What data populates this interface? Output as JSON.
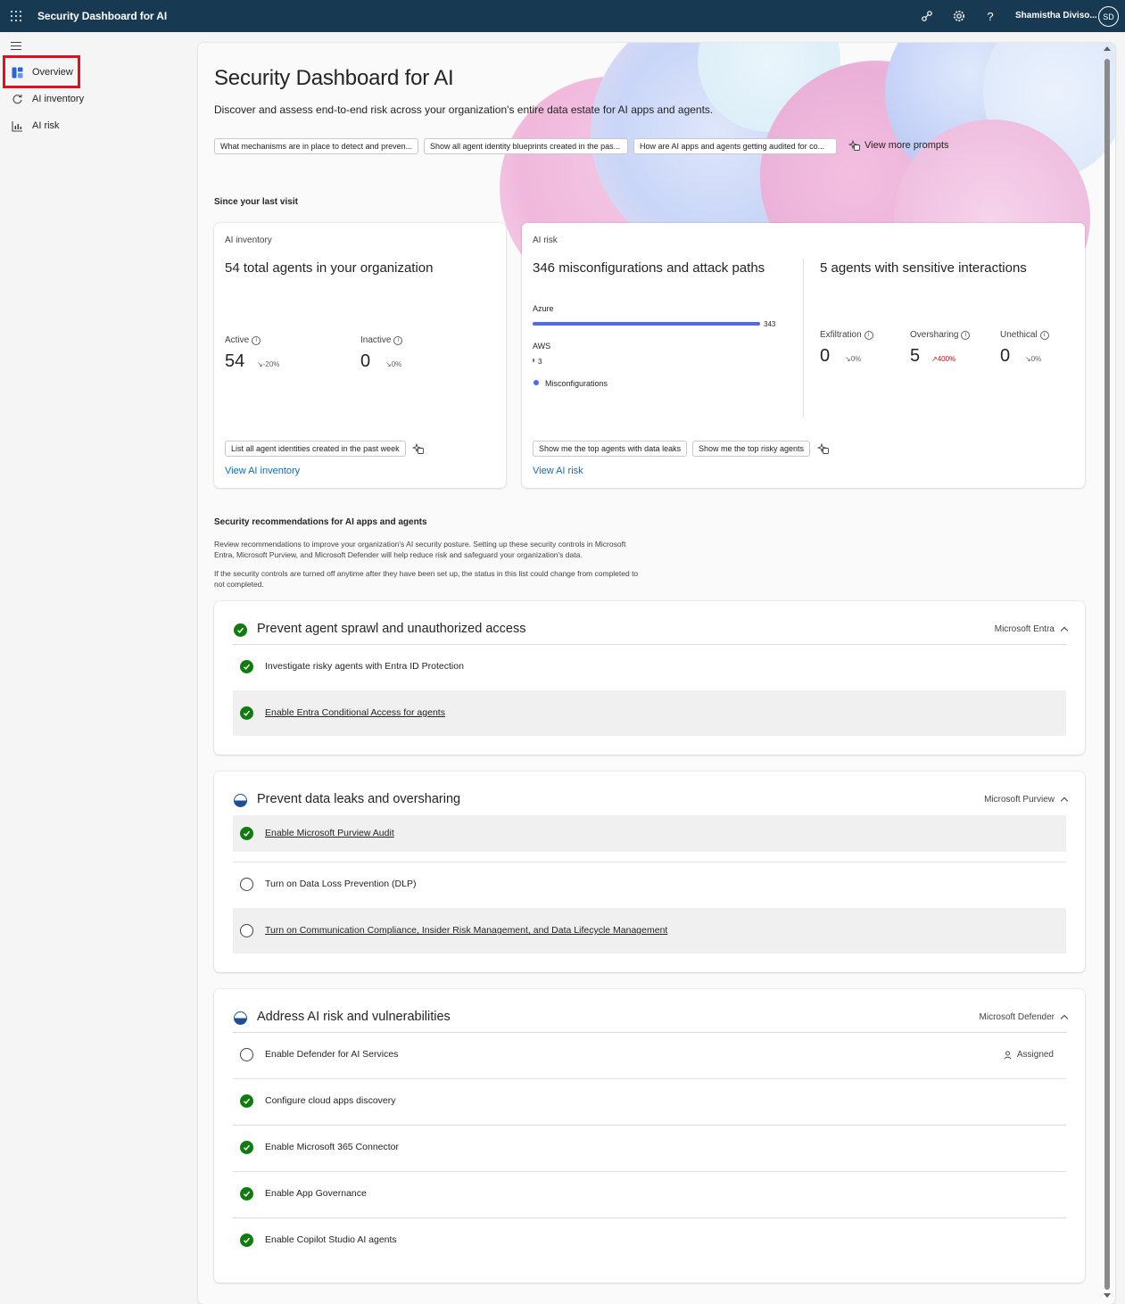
{
  "app": {
    "title": "Security Dashboard for AI",
    "user_name": "Shamistha Diviso...",
    "user_initials": "SD"
  },
  "nav": {
    "items": [
      {
        "label": "Overview",
        "icon": "overview-icon",
        "selected": true
      },
      {
        "label": "AI inventory",
        "icon": "inventory-icon"
      },
      {
        "label": "AI risk",
        "icon": "risk-chart-icon"
      }
    ]
  },
  "header": {
    "title": "Security Dashboard for AI",
    "subtitle": "Discover and assess end-to-end risk across your organization's entire data estate for AI apps and agents.",
    "prompts": [
      "What mechanisms are in place to detect and preven...",
      "Show all agent identity blueprints created in the pas...",
      "How are AI apps and agents getting audited for co..."
    ],
    "view_more": "View more prompts"
  },
  "since_last_visit": {
    "label": "Since your last visit",
    "inventory_card": {
      "label": "AI inventory",
      "headline": "54 total agents in your organization",
      "metrics": [
        {
          "label": "Active",
          "value": "54",
          "trend": "-20%",
          "direction": "down"
        },
        {
          "label": "Inactive",
          "value": "0",
          "trend": "0%",
          "direction": "down"
        }
      ],
      "chip": "List all agent identities created in the past week",
      "link": "View AI inventory"
    },
    "risk_card": {
      "label": "AI risk",
      "headline_left": "346 misconfigurations and attack paths",
      "headline_right": "5 agents with sensitive interactions",
      "bars": [
        {
          "label": "Azure",
          "value": 343
        },
        {
          "label": "AWS",
          "value": 3
        }
      ],
      "bar_color": "#4f6bed",
      "legend": "Misconfigurations",
      "metrics": [
        {
          "label": "Exfiltration",
          "value": "0",
          "trend": "0%",
          "direction": "down"
        },
        {
          "label": "Oversharing",
          "value": "5",
          "trend": "400%",
          "direction": "up"
        },
        {
          "label": "Unethical",
          "value": "0",
          "trend": "0%",
          "direction": "down"
        }
      ],
      "chips": [
        "Show me the top agents with data leaks",
        "Show me the top risky agents"
      ],
      "link": "View AI risk"
    }
  },
  "recommendations": {
    "label": "Security recommendations for AI apps and agents",
    "desc1": "Review recommendations to improve your organization's AI security posture. Setting up these security controls in Microsoft Entra, Microsoft Purview, and Microsoft Defender will help reduce risk and safeguard your organization's data.",
    "desc2": "If the security controls are turned off anytime after they have been set up, the status in this list could change from completed to not completed.",
    "groups": [
      {
        "title": "Prevent agent sprawl and unauthorized access",
        "vendor": "Microsoft Entra",
        "status": "complete",
        "items": [
          {
            "text": "Investigate risky agents with Entra ID Protection",
            "status": "complete"
          },
          {
            "text": "Enable Entra Conditional Access for agents",
            "status": "complete",
            "link": true
          }
        ]
      },
      {
        "title": "Prevent data leaks and oversharing",
        "vendor": "Microsoft Purview",
        "status": "partial",
        "items": [
          {
            "text": "Enable Microsoft Purview Audit",
            "status": "complete",
            "link": true
          },
          {
            "text": "Turn on Data Loss Prevention (DLP)",
            "status": "incomplete"
          },
          {
            "text": "Turn on Communication Compliance, Insider Risk Management, and Data Lifecycle Management",
            "status": "incomplete",
            "link": true
          }
        ]
      },
      {
        "title": "Address AI risk and vulnerabilities",
        "vendor": "Microsoft Defender",
        "status": "partial",
        "items": [
          {
            "text": "Enable Defender for AI Services",
            "status": "incomplete",
            "badge": "Assigned"
          },
          {
            "text": "Configure cloud apps discovery",
            "status": "complete"
          },
          {
            "text": "Enable Microsoft 365 Connector",
            "status": "complete"
          },
          {
            "text": "Enable App Governance",
            "status": "complete"
          },
          {
            "text": "Enable Copilot Studio AI agents",
            "status": "complete"
          }
        ]
      }
    ]
  },
  "colors": {
    "topbar": "#173a52",
    "link": "#0f6cbd",
    "success": "#107c10",
    "trend_up": "#c50f1f",
    "selection_highlight": "#e0101f"
  }
}
